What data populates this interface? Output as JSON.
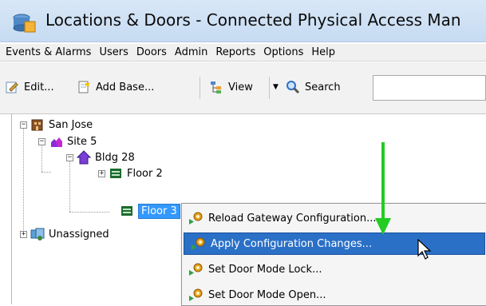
{
  "window": {
    "title": "Locations & Doors - Connected Physical Access Man"
  },
  "menubar": {
    "items": [
      "Events & Alarms",
      "Users",
      "Doors",
      "Admin",
      "Reports",
      "Options",
      "Help"
    ]
  },
  "toolbar": {
    "edit_label": "Edit...",
    "add_base_label": "Add Base...",
    "view_label": "View",
    "search_label": "Search",
    "search_value": ""
  },
  "tree": {
    "nodes": [
      {
        "label": "San Jose",
        "icon": "building-brown-icon",
        "expanded": true
      },
      {
        "label": "Site 5",
        "icon": "site-icon",
        "expanded": true
      },
      {
        "label": "Bldg 28",
        "icon": "house-icon",
        "expanded": true
      },
      {
        "label": "Floor 2",
        "icon": "floor-icon",
        "expanded": false
      },
      {
        "label": "Floor 3",
        "icon": "floor-icon",
        "selected": true
      },
      {
        "label": "Unassigned",
        "icon": "unassigned-icon",
        "expanded": false
      }
    ]
  },
  "context_menu": {
    "items": [
      {
        "label": "Reload Gateway Configuration...",
        "icon": "gear-run-icon"
      },
      {
        "label": "Apply Configuration Changes...",
        "icon": "gear-run-icon",
        "highlighted": true
      },
      {
        "label": "Set Door Mode Lock...",
        "icon": "gear-run-icon"
      },
      {
        "label": "Set Door Mode Open...",
        "icon": "gear-run-icon"
      }
    ]
  },
  "annotation": {
    "arrow_color": "#22cc22",
    "direction": "down"
  },
  "colors": {
    "selection": "#3399ff",
    "menu_highlight": "#2b70c7",
    "titlebar": "#c6dbf2"
  }
}
